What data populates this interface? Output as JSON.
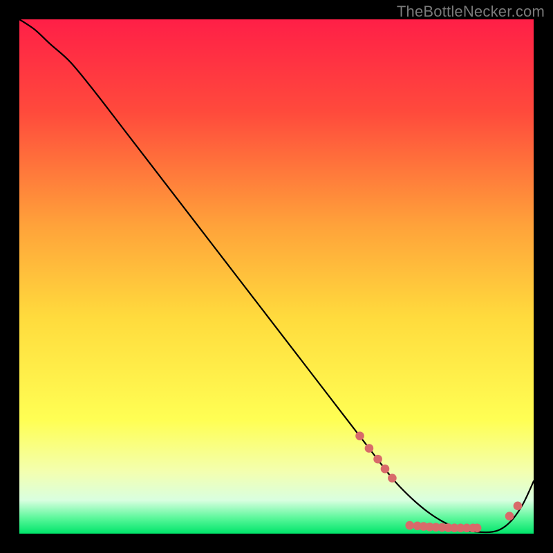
{
  "branding": {
    "watermark": "TheBottleNecker.com"
  },
  "chart_data": {
    "type": "line",
    "title": "",
    "xlabel": "",
    "ylabel": "",
    "xlim": [
      0,
      100
    ],
    "ylim": [
      0,
      100
    ],
    "gradient_stops": [
      {
        "offset": 0.0,
        "color": "#ff1f47"
      },
      {
        "offset": 0.18,
        "color": "#ff4a3c"
      },
      {
        "offset": 0.4,
        "color": "#ffa23a"
      },
      {
        "offset": 0.58,
        "color": "#ffdb3d"
      },
      {
        "offset": 0.78,
        "color": "#ffff54"
      },
      {
        "offset": 0.88,
        "color": "#f3ffb0"
      },
      {
        "offset": 0.935,
        "color": "#d9ffe0"
      },
      {
        "offset": 0.97,
        "color": "#5af79a"
      },
      {
        "offset": 1.0,
        "color": "#00e56a"
      }
    ],
    "series": [
      {
        "name": "bottleneck-curve",
        "color": "#000000",
        "width": 2.2,
        "x": [
          0,
          3,
          6,
          10,
          15,
          20,
          25,
          30,
          35,
          40,
          45,
          50,
          55,
          60,
          64,
          68,
          72,
          74,
          77,
          80,
          83,
          86,
          89,
          92,
          94,
          96,
          98,
          100
        ],
        "y": [
          100,
          98,
          95.2,
          91.6,
          85.5,
          79.0,
          72.5,
          66.0,
          59.5,
          53.0,
          46.5,
          40.0,
          33.5,
          27.0,
          21.8,
          16.6,
          11.4,
          9.1,
          6.2,
          3.8,
          2.0,
          0.9,
          0.35,
          0.35,
          1.1,
          2.9,
          5.9,
          10.2
        ]
      }
    ],
    "markers": {
      "name": "highlight-dots",
      "color": "#d86a6a",
      "radius": 6.3,
      "note": "salmon dots along the valley and right upslope",
      "points": [
        {
          "x": 66.2,
          "y": 19.0
        },
        {
          "x": 68.0,
          "y": 16.6
        },
        {
          "x": 69.7,
          "y": 14.5
        },
        {
          "x": 71.1,
          "y": 12.6
        },
        {
          "x": 72.5,
          "y": 10.8
        },
        {
          "x": 75.9,
          "y": 1.6
        },
        {
          "x": 77.4,
          "y": 1.5
        },
        {
          "x": 78.6,
          "y": 1.4
        },
        {
          "x": 79.8,
          "y": 1.3
        },
        {
          "x": 81.0,
          "y": 1.25
        },
        {
          "x": 82.2,
          "y": 1.2
        },
        {
          "x": 83.4,
          "y": 1.15
        },
        {
          "x": 84.6,
          "y": 1.12
        },
        {
          "x": 85.8,
          "y": 1.1
        },
        {
          "x": 87.0,
          "y": 1.1
        },
        {
          "x": 88.2,
          "y": 1.1
        },
        {
          "x": 89.0,
          "y": 1.1
        },
        {
          "x": 95.3,
          "y": 3.4
        },
        {
          "x": 96.9,
          "y": 5.4
        }
      ]
    }
  }
}
